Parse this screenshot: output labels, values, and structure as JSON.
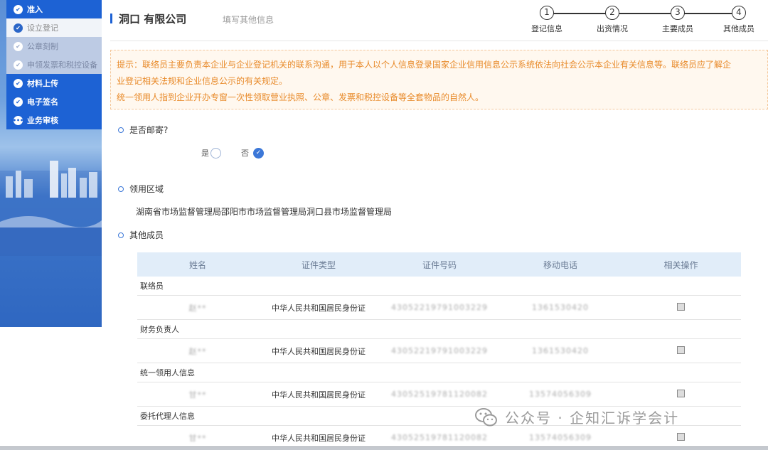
{
  "sidebar": {
    "items": [
      {
        "label": "准入",
        "type": "main"
      },
      {
        "label": "设立登记",
        "type": "active"
      },
      {
        "label": "公章刻制",
        "type": "sub"
      },
      {
        "label": "申领发票和税控设备",
        "type": "sub"
      },
      {
        "label": "材料上传",
        "type": "main"
      },
      {
        "label": "电子签名",
        "type": "main"
      },
      {
        "label": "业务审核",
        "type": "main"
      }
    ]
  },
  "header": {
    "company": "洞口        有限公司",
    "subtitle": "填写其他信息",
    "steps": [
      {
        "num": "1",
        "label": "登记信息"
      },
      {
        "num": "2",
        "label": "出资情况"
      },
      {
        "num": "3",
        "label": "主要成员"
      },
      {
        "num": "4",
        "label": "其他成员"
      }
    ]
  },
  "notice": {
    "line1": "提示：联络员主要负责本企业与企业登记机关的联系沟通，用于本人以个人信息登录国家企业信用信息公示系统依法向社会公示本企业有关信息等。联络员应了解企",
    "line2": "业登记相关法规和企业信息公示的有关规定。",
    "line3": "统一领用人指到企业开办专窗一次性领取营业执照、公章、发票和税控设备等全套物品的自然人。"
  },
  "mail": {
    "label": "是否邮寄?",
    "yes": "是",
    "no": "否"
  },
  "region": {
    "label": "领用区域",
    "value": "湖南省市场监督管理局邵阳市市场监督管理局洞口县市场监督管理局"
  },
  "members": {
    "label": "其他成员",
    "columns": [
      "姓名",
      "证件类型",
      "证件号码",
      "移动电话",
      "相关操作"
    ],
    "groups": [
      {
        "title": "联络员",
        "name": "赵**",
        "idtype": "中华人民共和国居民身份证",
        "idno": "43052219791003229",
        "phone": "1361530420"
      },
      {
        "title": "财务负责人",
        "name": "赵**",
        "idtype": "中华人民共和国居民身份证",
        "idno": "43052219791003229",
        "phone": "1361530420"
      },
      {
        "title": "统一领用人信息",
        "name": "甘**",
        "idtype": "中华人民共和国居民身份证",
        "idno": "43052519781120082",
        "phone": "13574056309"
      },
      {
        "title": "委托代理人信息",
        "name": "甘**",
        "idtype": "中华人民共和国居民身份证",
        "idno": "43052519781120082",
        "phone": "13574056309"
      }
    ]
  },
  "watermark": "公众号 · 企知汇诉学会计"
}
